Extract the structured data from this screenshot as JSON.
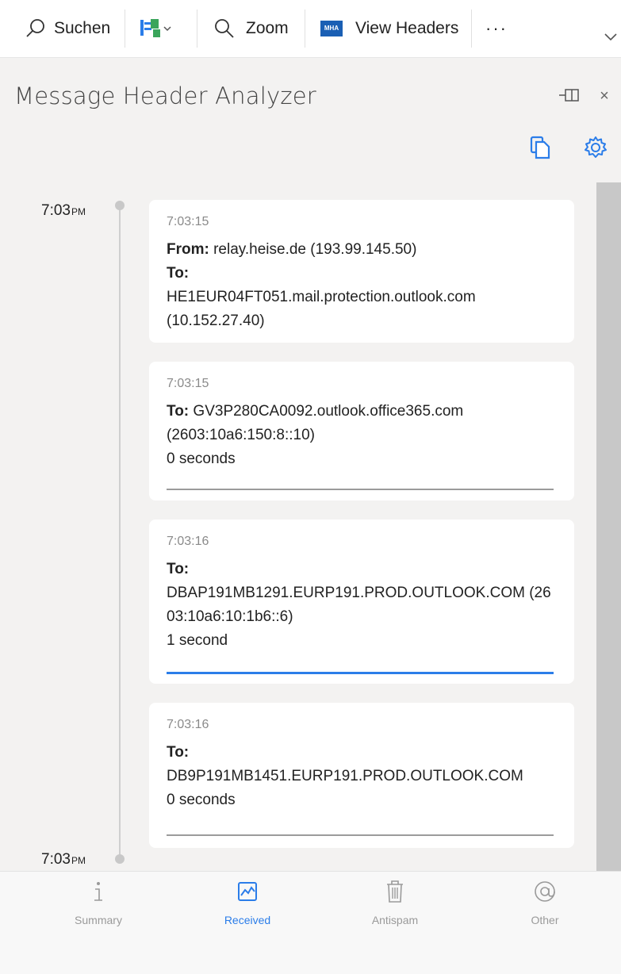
{
  "toolbar": {
    "search_label": "Suchen",
    "zoom_label": "Zoom",
    "view_headers_label": "View Headers",
    "mha_badge": "MHA",
    "more_label": "···"
  },
  "pane": {
    "title": "Message Header Analyzer",
    "close_glyph": "×"
  },
  "timeline": {
    "start_time": "7:03",
    "start_ampm": "PM",
    "end_time": "7:03",
    "end_ampm": "PM"
  },
  "hops": [
    {
      "time": "7:03:15",
      "from_label": "From:",
      "from_value": "relay.heise.de (193.99.145.50)",
      "to_label": "To:",
      "to_value": "HE1EUR04FT051.mail.protection.outlook.com (10.152.27.40)"
    },
    {
      "time": "7:03:15",
      "to_label": "To:",
      "to_value": "GV3P280CA0092.outlook.office365.com (2603:10a6:150:8::10)",
      "delay": "0 seconds"
    },
    {
      "time": "7:03:16",
      "to_label": "To:",
      "to_value": "DBAP191MB1291.EURP191.PROD.OUTLOOK.COM (2603:10a6:10:1b6::6)",
      "delay": "1 second"
    },
    {
      "time": "7:03:16",
      "to_label": "To:",
      "to_value": "DB9P191MB1451.EURP191.PROD.OUTLOOK.COM",
      "delay": "0 seconds"
    }
  ],
  "nav": {
    "summary": "Summary",
    "received": "Received",
    "antispam": "Antispam",
    "other": "Other",
    "active": "Received"
  },
  "colors": {
    "accent": "#2b7de9",
    "background": "#f3f2f1"
  }
}
